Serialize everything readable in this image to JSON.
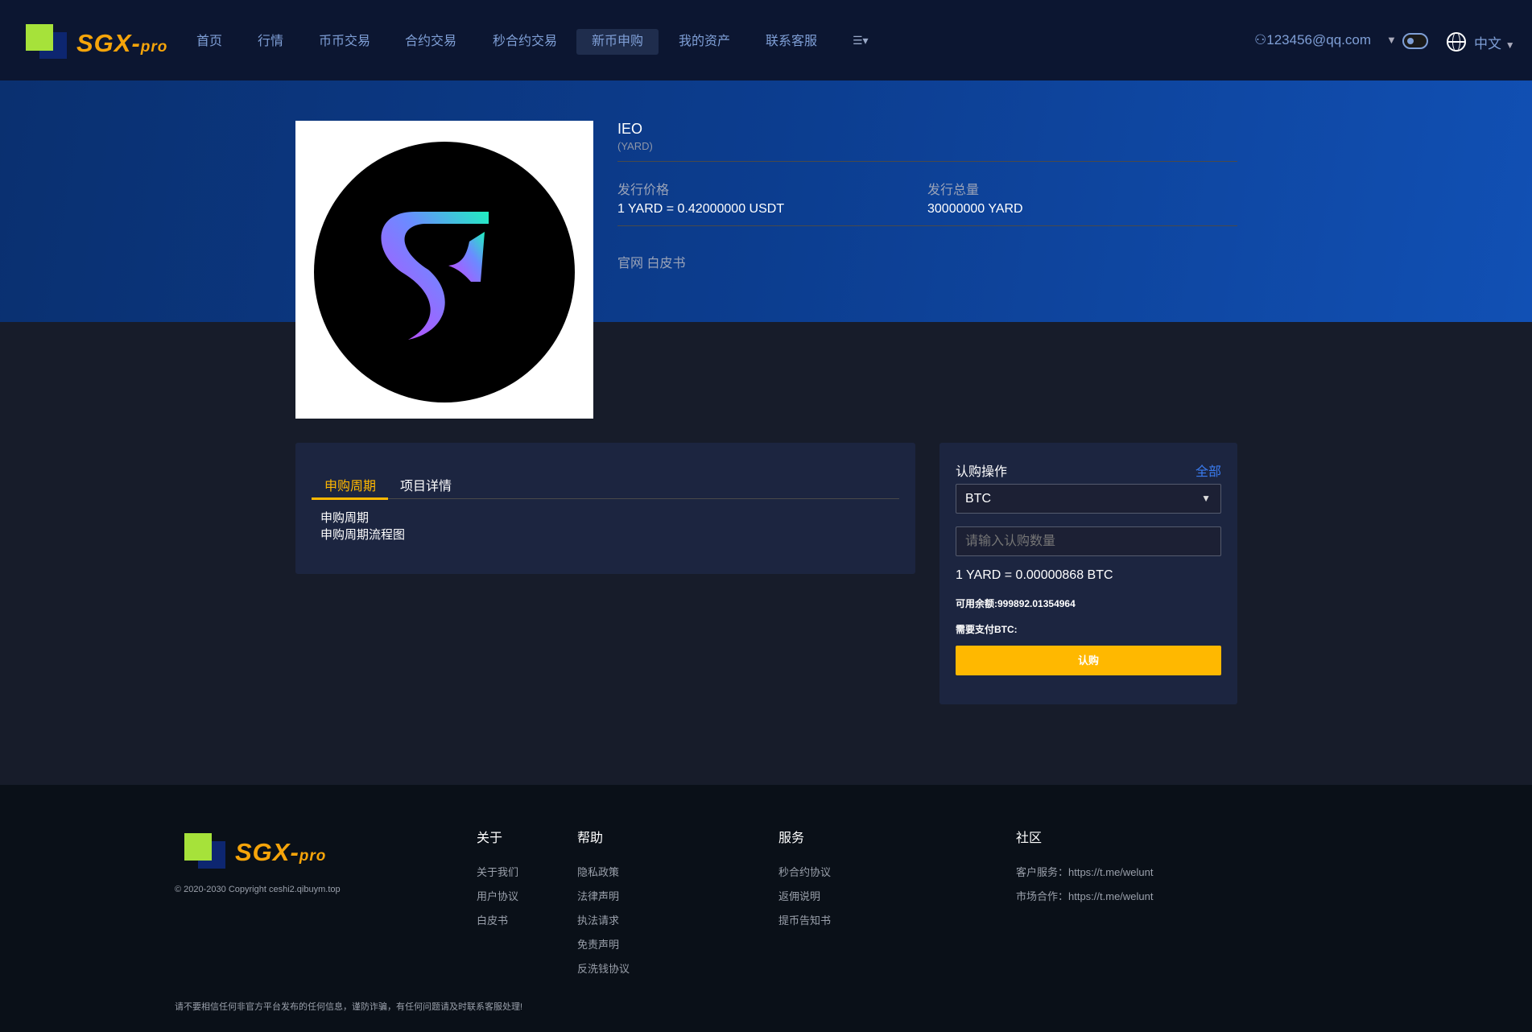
{
  "header": {
    "logo": {
      "main": "SGX-",
      "suffix": "pro"
    },
    "nav": [
      "首页",
      "行情",
      "币币交易",
      "合约交易",
      "秒合约交易",
      "新币申购",
      "我的资产",
      "联系客服"
    ],
    "active_nav": "新币申购",
    "user_email": "123456@qq.com",
    "language": "中文"
  },
  "coin": {
    "name": "IEO",
    "symbol": "(YARD)",
    "price_label": "发行价格",
    "price_value": "1 YARD = 0.42000000 USDT",
    "total_label": "发行总量",
    "total_value": "30000000 YARD",
    "link_website": "官网",
    "link_whitepaper": "白皮书"
  },
  "tabs": {
    "items": [
      "申购周期",
      "项目详情"
    ],
    "content": [
      "申购周期",
      "申购周期流程图"
    ]
  },
  "subscribe": {
    "title": "认购操作",
    "all_link": "全部",
    "currency": "BTC",
    "amount_placeholder": "请输入认购数量",
    "rate": "1 YARD = 0.00000868 BTC",
    "balance": "可用余额:999892.01354964",
    "need_pay": "需要支付BTC:",
    "button": "认购"
  },
  "footer": {
    "copyright": "© 2020-2030 Copyright ceshi2.qibuym.top",
    "columns": [
      {
        "title": "关于",
        "items": [
          "关于我们",
          "用户协议",
          "白皮书"
        ]
      },
      {
        "title": "帮助",
        "items": [
          "隐私政策",
          "法律声明",
          "执法请求",
          "免责声明",
          "反洗钱协议"
        ]
      },
      {
        "title": "服务",
        "items": [
          "秒合约协议",
          "返佣说明",
          "提币告知书"
        ]
      },
      {
        "title": "社区",
        "items": [
          "客户服务：https://t.me/welunt",
          "市场合作：https://t.me/welunt"
        ]
      }
    ],
    "warning": "请不要相信任何非官方平台发布的任何信息，谨防诈骗，有任何问题请及时联系客服处理!"
  },
  "colors": {
    "accent": "#ffb800",
    "link": "#3a7bef",
    "nav": "#7f9fd6"
  }
}
